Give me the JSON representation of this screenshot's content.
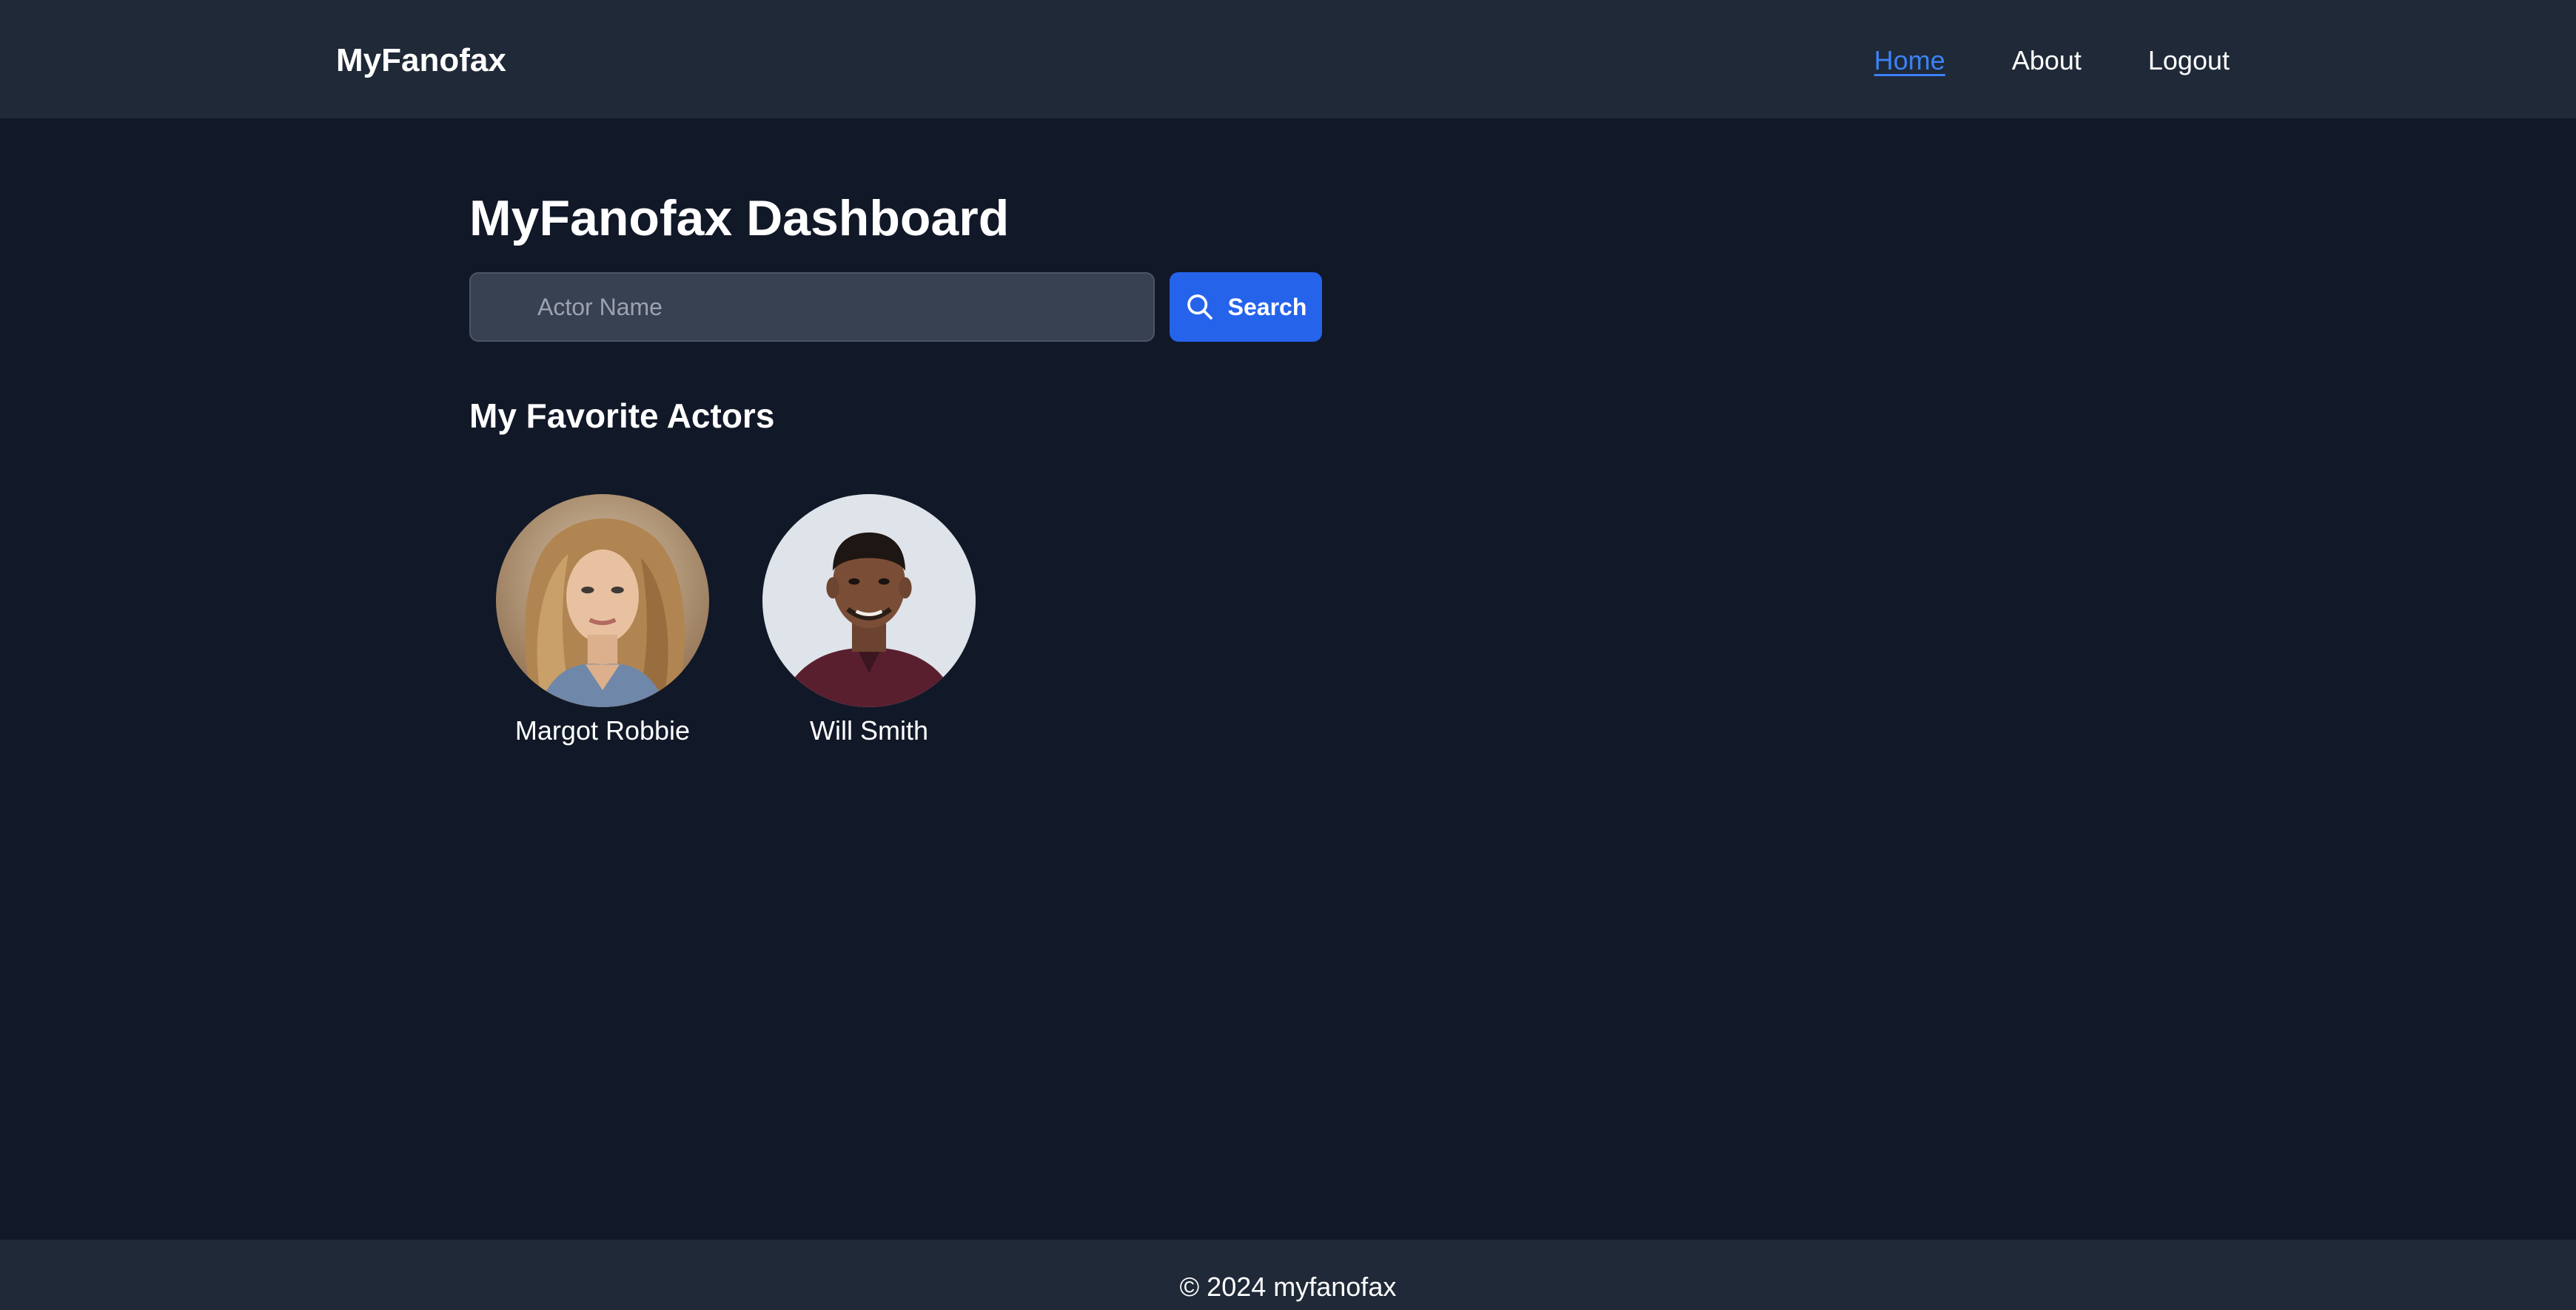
{
  "header": {
    "brand": "MyFanofax",
    "nav": {
      "home": "Home",
      "about": "About",
      "logout": "Logout"
    }
  },
  "main": {
    "title": "MyFanofax Dashboard",
    "search": {
      "placeholder": "Actor Name",
      "value": "",
      "button_label": "Search",
      "icon": "search-icon"
    },
    "favorites": {
      "title": "My Favorite Actors",
      "actors": [
        {
          "name": "Margot Robbie"
        },
        {
          "name": "Will Smith"
        }
      ]
    }
  },
  "footer": {
    "text": "© 2024 myfanofax"
  },
  "colors": {
    "background": "#111827",
    "header_footer": "#1f2937",
    "accent": "#2563eb",
    "active_link": "#3b82f6",
    "input_bg": "#374151"
  }
}
